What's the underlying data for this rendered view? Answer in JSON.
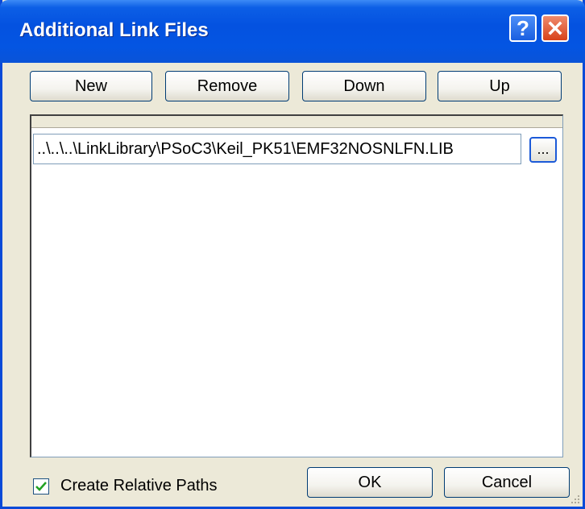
{
  "window": {
    "title": "Additional Link Files",
    "help_symbol": "?",
    "close_icon": "close-icon"
  },
  "toolbar": {
    "new_label": "New",
    "remove_label": "Remove",
    "down_label": "Down",
    "up_label": "Up"
  },
  "list": {
    "items": [
      {
        "path": "..\\..\\..\\LinkLibrary\\PSoC3\\Keil_PK51\\EMF32NOSNLFN.LIB",
        "browse_label": "..."
      }
    ]
  },
  "footer": {
    "checkbox_label": "Create Relative Paths",
    "checkbox_checked": true,
    "ok_label": "OK",
    "cancel_label": "Cancel"
  },
  "colors": {
    "titlebar": "#0455e2",
    "frame": "#0a4ad8",
    "dialog_bg": "#ece9d8",
    "close_button": "#d8421a",
    "check_mark": "#21a121"
  }
}
